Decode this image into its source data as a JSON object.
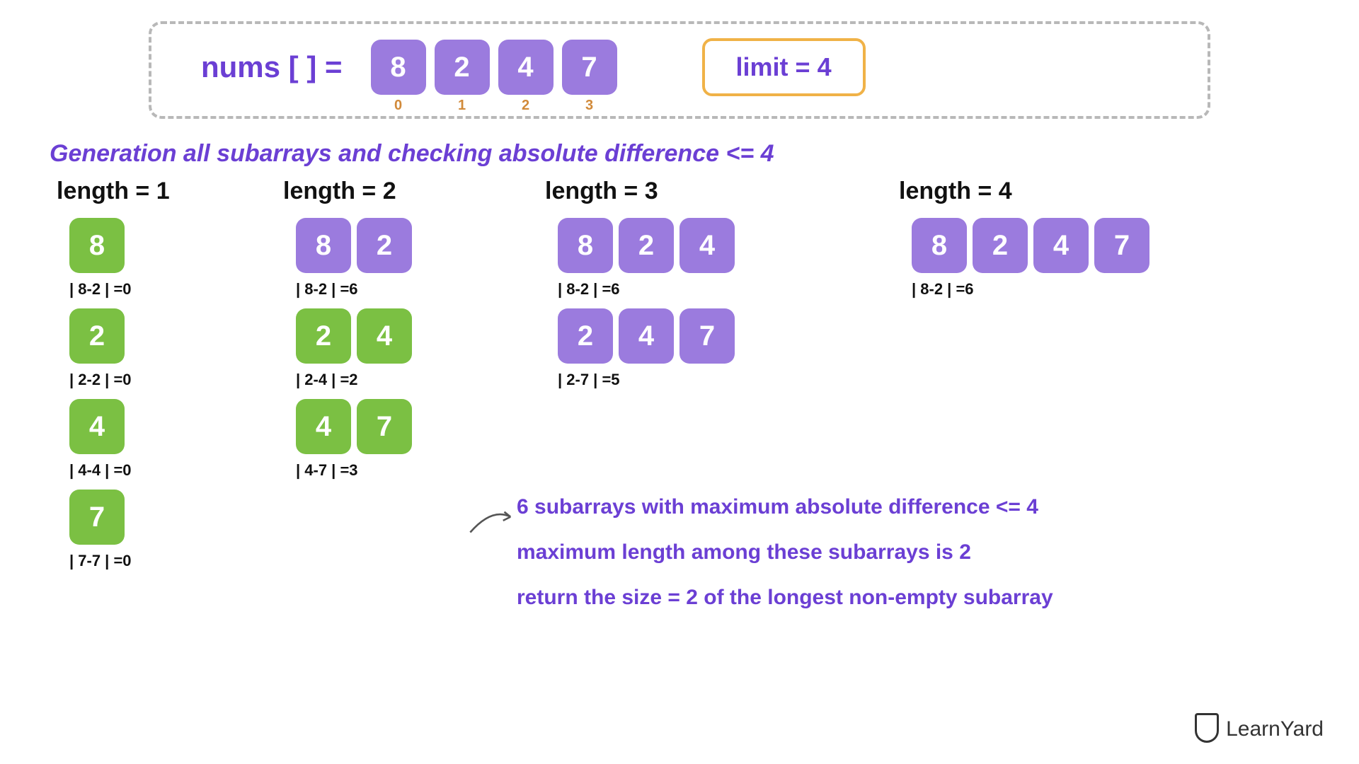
{
  "header": {
    "nums_label": "nums [ ]  = ",
    "values": [
      "8",
      "2",
      "4",
      "7"
    ],
    "indices": [
      "0",
      "1",
      "2",
      "3"
    ],
    "limit_text": "limit = 4"
  },
  "subtitle": "Generation all subarrays and checking absolute difference <= 4",
  "columns": [
    {
      "header": "length  = 1",
      "subarrays": [
        {
          "values": [
            "8"
          ],
          "color": "green",
          "diff": "| 8-2 | =0"
        },
        {
          "values": [
            "2"
          ],
          "color": "green",
          "diff": "| 2-2 | =0"
        },
        {
          "values": [
            "4"
          ],
          "color": "green",
          "diff": "| 4-4 | =0"
        },
        {
          "values": [
            "7"
          ],
          "color": "green",
          "diff": "| 7-7 | =0"
        }
      ]
    },
    {
      "header": "length  = 2",
      "subarrays": [
        {
          "values": [
            "8",
            "2"
          ],
          "color": "purple",
          "diff": "| 8-2 | =6"
        },
        {
          "values": [
            "2",
            "4"
          ],
          "color": "green",
          "diff": "| 2-4 | =2"
        },
        {
          "values": [
            "4",
            "7"
          ],
          "color": "green",
          "diff": "| 4-7 | =3"
        }
      ]
    },
    {
      "header": "length  = 3",
      "subarrays": [
        {
          "values": [
            "8",
            "2",
            "4"
          ],
          "color": "purple",
          "diff": "| 8-2 | =6"
        },
        {
          "values": [
            "2",
            "4",
            "7"
          ],
          "color": "purple",
          "diff": "| 2-7 | =5"
        }
      ]
    },
    {
      "header": "length  = 4",
      "subarrays": [
        {
          "values": [
            "8",
            "2",
            "4",
            "7"
          ],
          "color": "purple",
          "diff": "| 8-2 | =6"
        }
      ]
    }
  ],
  "summary": [
    "6 subarrays with maximum absolute difference <= 4",
    "maximum length among these subarrays is 2",
    "return the size = 2 of the longest non-empty subarray"
  ],
  "logo_text": "LearnYard"
}
